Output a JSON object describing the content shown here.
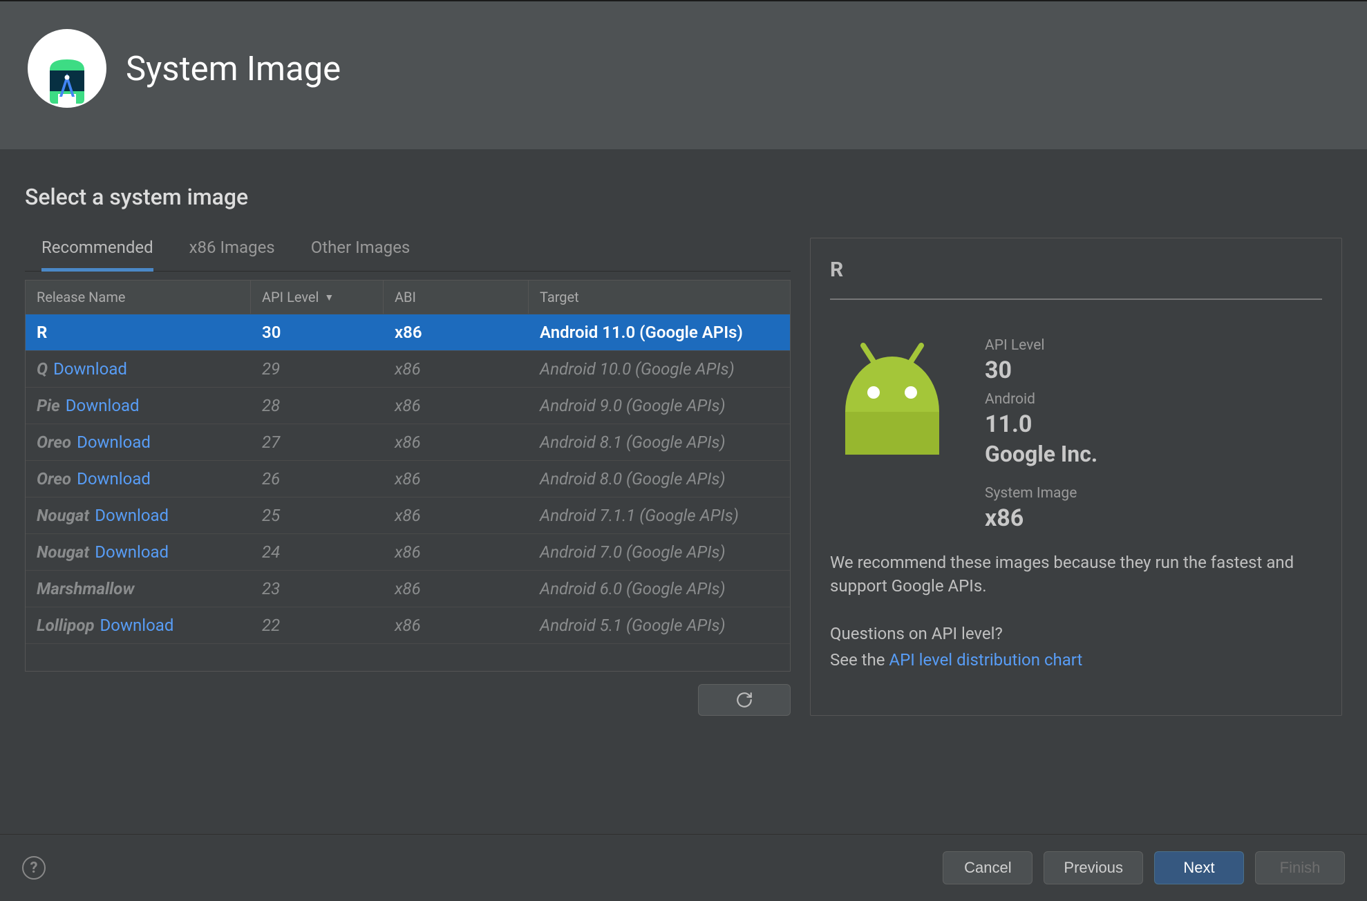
{
  "header": {
    "title": "System Image"
  },
  "subtitle": "Select a system image",
  "tabs": [
    {
      "label": "Recommended",
      "active": true
    },
    {
      "label": "x86 Images",
      "active": false
    },
    {
      "label": "Other Images",
      "active": false
    }
  ],
  "table": {
    "columns": [
      {
        "label": "Release Name"
      },
      {
        "label": "API Level",
        "sorted": "desc"
      },
      {
        "label": "ABI"
      },
      {
        "label": "Target"
      }
    ],
    "rows": [
      {
        "release": "R",
        "download": false,
        "api": "30",
        "abi": "x86",
        "target": "Android 11.0 (Google APIs)",
        "selected": true
      },
      {
        "release": "Q",
        "download": true,
        "api": "29",
        "abi": "x86",
        "target": "Android 10.0 (Google APIs)",
        "selected": false
      },
      {
        "release": "Pie",
        "download": true,
        "api": "28",
        "abi": "x86",
        "target": "Android 9.0 (Google APIs)",
        "selected": false
      },
      {
        "release": "Oreo",
        "download": true,
        "api": "27",
        "abi": "x86",
        "target": "Android 8.1 (Google APIs)",
        "selected": false
      },
      {
        "release": "Oreo",
        "download": true,
        "api": "26",
        "abi": "x86",
        "target": "Android 8.0 (Google APIs)",
        "selected": false
      },
      {
        "release": "Nougat",
        "download": true,
        "api": "25",
        "abi": "x86",
        "target": "Android 7.1.1 (Google APIs)",
        "selected": false
      },
      {
        "release": "Nougat",
        "download": true,
        "api": "24",
        "abi": "x86",
        "target": "Android 7.0 (Google APIs)",
        "selected": false
      },
      {
        "release": "Marshmallow",
        "download": false,
        "api": "23",
        "abi": "x86",
        "target": "Android 6.0 (Google APIs)",
        "selected": false
      },
      {
        "release": "Lollipop",
        "download": true,
        "api": "22",
        "abi": "x86",
        "target": "Android 5.1 (Google APIs)",
        "selected": false
      }
    ],
    "download_label": "Download"
  },
  "detail": {
    "title": "R",
    "api_label": "API Level",
    "api_value": "30",
    "platform_label": "Android",
    "platform_value": "11.0",
    "vendor": "Google Inc.",
    "sysimg_label": "System Image",
    "sysimg_value": "x86",
    "recommend_text": "We recommend these images because they run the fastest and support Google APIs.",
    "question_text": "Questions on API level?",
    "see_prefix": "See the ",
    "link_text": "API level distribution chart"
  },
  "footer": {
    "cancel": "Cancel",
    "previous": "Previous",
    "next": "Next",
    "finish": "Finish"
  },
  "colors": {
    "accent": "#1d6bbd",
    "link": "#589df6",
    "android_green": "#a4c639"
  }
}
